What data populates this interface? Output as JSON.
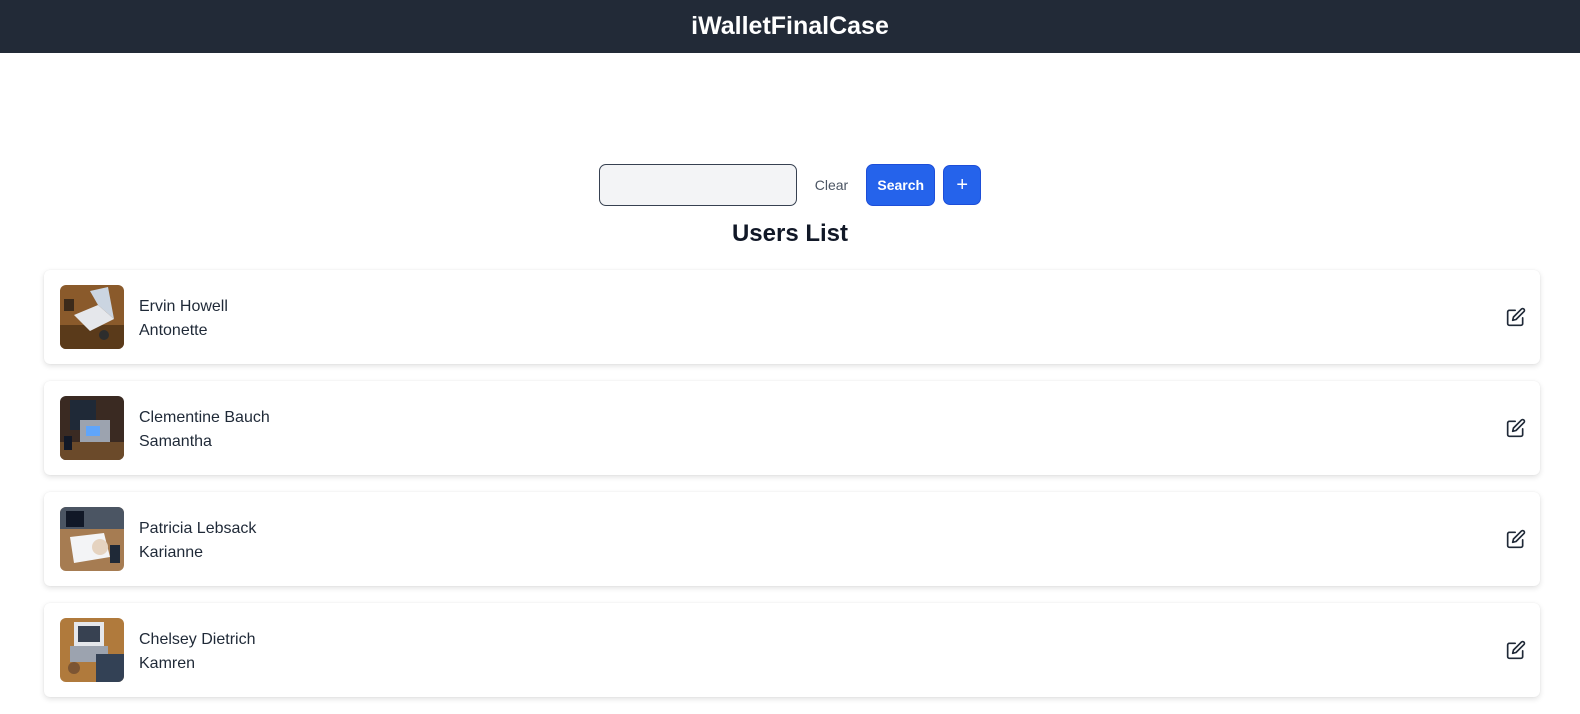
{
  "header": {
    "title": "iWalletFinalCase"
  },
  "search": {
    "placeholder": "",
    "value": "",
    "clear_label": "Clear",
    "search_label": "Search",
    "add_label": "+"
  },
  "list": {
    "title": "Users List",
    "users": [
      {
        "name": "Ervin Howell",
        "username": "Antonette"
      },
      {
        "name": "Clementine Bauch",
        "username": "Samantha"
      },
      {
        "name": "Patricia Lebsack",
        "username": "Karianne"
      },
      {
        "name": "Chelsey Dietrich",
        "username": "Kamren"
      }
    ]
  },
  "icons": {
    "edit": "edit-icon",
    "avatar": "laptop-photo"
  },
  "colors": {
    "header_bg": "#222a37",
    "accent": "#2563eb"
  }
}
